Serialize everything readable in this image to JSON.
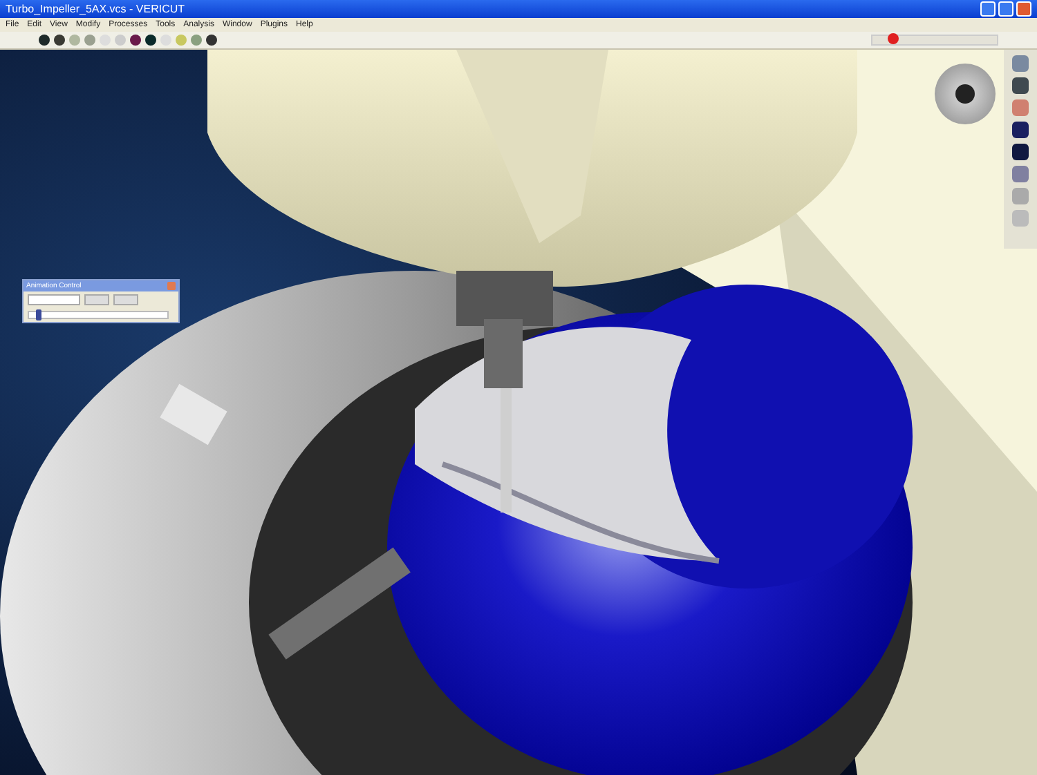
{
  "window": {
    "title": "Turbo_Impeller_5AX.vcs - VERICUT"
  },
  "menu": [
    "File",
    "Edit",
    "View",
    "Modify",
    "Processes",
    "Tools",
    "Analysis",
    "Window",
    "Plugins",
    "Help"
  ],
  "speed_slider": {
    "level": 0.12
  },
  "floating_dialog": {
    "title": "Animation Control",
    "slider": {
      "level": 0.05
    }
  }
}
